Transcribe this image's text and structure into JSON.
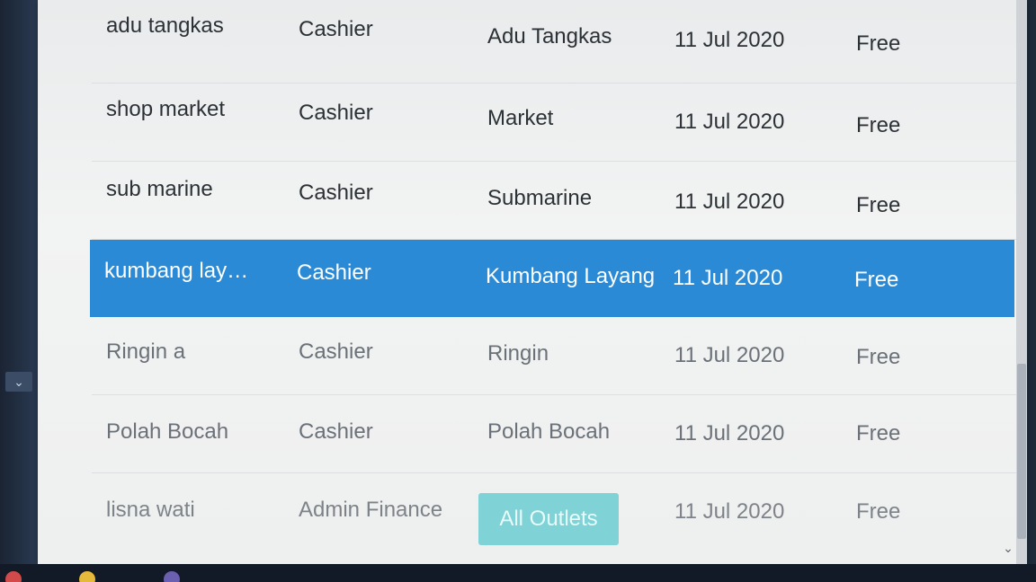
{
  "table": {
    "rows": [
      {
        "name": "adu tangkas",
        "role": "Cashier",
        "outlet": "Adu Tangkas",
        "date": "11 Jul 2020",
        "plan": "Free"
      },
      {
        "name": "shop market",
        "role": "Cashier",
        "outlet": "Market",
        "date": "11 Jul 2020",
        "plan": "Free"
      },
      {
        "name": "sub marine",
        "role": "Cashier",
        "outlet": "Submarine",
        "date": "11 Jul 2020",
        "plan": "Free"
      },
      {
        "name": "kumbang lay…",
        "role": "Cashier",
        "outlet": "Kumbang Layang",
        "date": "11 Jul 2020",
        "plan": "Free"
      },
      {
        "name": "Ringin a",
        "role": "Cashier",
        "outlet": "Ringin",
        "date": "11 Jul 2020",
        "plan": "Free"
      },
      {
        "name": "Polah Bocah",
        "role": "Cashier",
        "outlet": "Polah Bocah",
        "date": "11 Jul 2020",
        "plan": "Free"
      },
      {
        "name": "lisna wati",
        "role": "Admin Finance",
        "outlet": "All Outlets",
        "date": "11 Jul 2020",
        "plan": "Free"
      }
    ]
  },
  "scroll": {
    "left_arrow_icon": "chevron-down-icon",
    "right_arrow_icon": "chevron-down-icon",
    "left_arrow_glyph": "⌄",
    "right_arrow_glyph": "⌄"
  },
  "colors": {
    "selected_row": "#2b8ad6",
    "outlet_badge": "#7fd2d5"
  }
}
